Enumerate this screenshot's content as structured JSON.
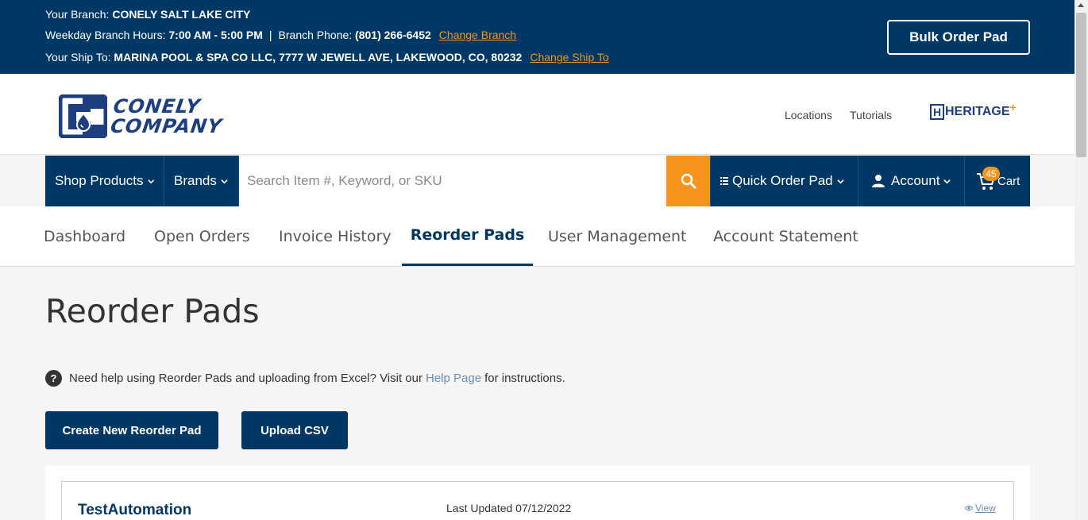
{
  "topbar": {
    "branch_label": "Your Branch: ",
    "branch_value": "CONELY SALT LAKE CITY",
    "hours_label": "Weekday Branch Hours: ",
    "hours_value": "7:00 AM - 5:00 PM",
    "separator": "|",
    "phone_label": "Branch Phone: ",
    "phone_value": "(801) 266-6452",
    "change_branch": "Change Branch",
    "shipto_label": "Your Ship To: ",
    "shipto_value": "MARINA POOL & SPA CO LLC, 7777 W JEWELL AVE, LAKEWOOD, CO, 80232",
    "change_shipto": "Change Ship To",
    "bulk_order": "Bulk Order Pad"
  },
  "header": {
    "logo_line1": "CONELY",
    "logo_line2": "COMPANY",
    "locations": "Locations",
    "tutorials": "Tutorials",
    "heritage_h": "H",
    "heritage_text": "HERITAGE",
    "heritage_plus": "+"
  },
  "nav": {
    "shop_products": "Shop Products",
    "brands": "Brands",
    "search_placeholder": "Search Item #, Keyword, or SKU",
    "quick_order": "Quick Order Pad",
    "account": "Account",
    "cart": "Cart",
    "cart_count": "45"
  },
  "tabs": [
    {
      "label": "Dashboard"
    },
    {
      "label": "Open Orders"
    },
    {
      "label": "Invoice History"
    },
    {
      "label": "Reorder Pads"
    },
    {
      "label": "User Management"
    },
    {
      "label": "Account Statement"
    }
  ],
  "active_tab": "Reorder Pads",
  "main": {
    "title": "Reorder Pads",
    "help_prefix": "Need help using Reorder Pads and uploading from Excel? Visit our",
    "help_link": "Help Page",
    "help_suffix": "for instructions.",
    "help_icon": "?",
    "create_btn": "Create New Reorder Pad",
    "upload_btn": "Upload CSV"
  },
  "pads": [
    {
      "name": "TestAutomation",
      "updated": "Last Updated 07/12/2022",
      "view": "View"
    }
  ],
  "colors": {
    "navy": "#003865",
    "orange": "#f7941d",
    "link_blue": "#6b8fb5"
  }
}
